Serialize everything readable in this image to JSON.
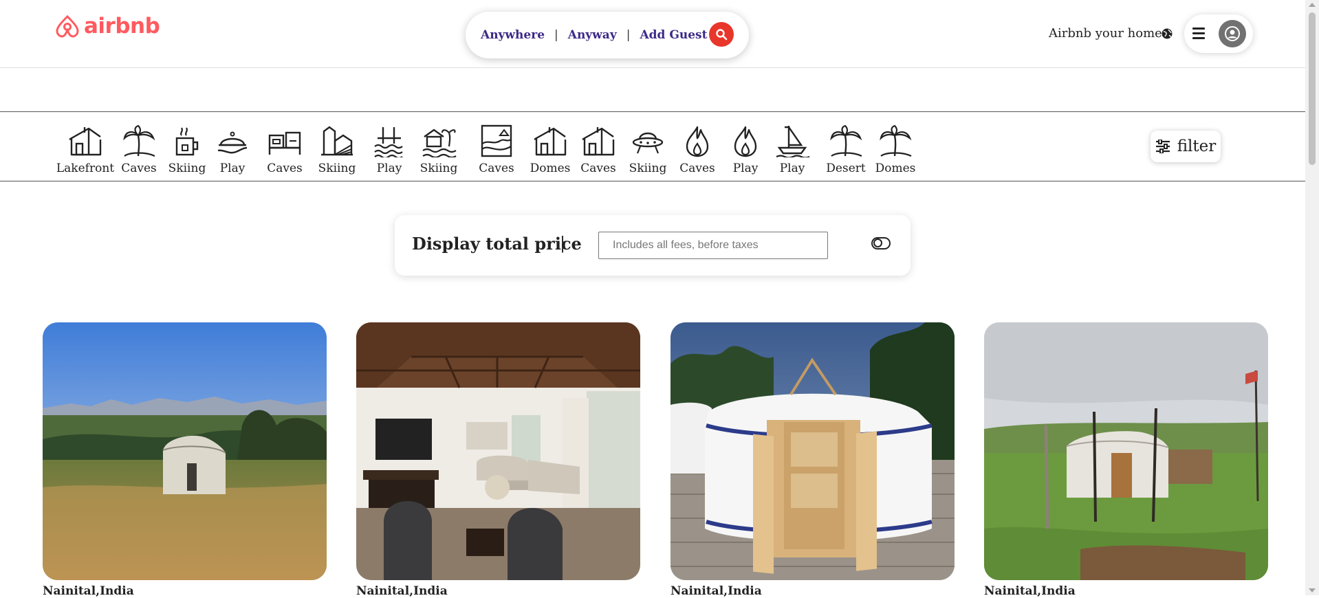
{
  "brand": {
    "name": "airbnb",
    "color": "#ff5a5f"
  },
  "search": {
    "segments": [
      "Anywhere",
      "Anyway",
      "Add Guest"
    ],
    "button_icon": "search-icon",
    "button_color": "#e8362a"
  },
  "header": {
    "host_link": "Airbnb your home",
    "globe_icon": "globe-icon",
    "menu_icon": "hamburger-icon",
    "avatar_icon": "user-avatar-icon"
  },
  "categories": [
    {
      "label": "Lakefront",
      "icon": "house-icon"
    },
    {
      "label": "Caves",
      "icon": "palm-tree-icon"
    },
    {
      "label": "Skiing",
      "icon": "hot-drink-icon"
    },
    {
      "label": "Play",
      "icon": "cloche-icon"
    },
    {
      "label": "Caves",
      "icon": "bed-icon"
    },
    {
      "label": "Skiing",
      "icon": "farm-icon"
    },
    {
      "label": "Play",
      "icon": "pier-icon"
    },
    {
      "label": "Skiing",
      "icon": "beach-hut-icon"
    },
    {
      "label": "Caves",
      "icon": "beachfront-icon"
    },
    {
      "label": "Domes",
      "icon": "house-icon"
    },
    {
      "label": "Caves",
      "icon": "house-icon"
    },
    {
      "label": "Skiing",
      "icon": "ufo-icon"
    },
    {
      "label": "Caves",
      "icon": "flame-icon"
    },
    {
      "label": "Play",
      "icon": "flame-icon"
    },
    {
      "label": "Play",
      "icon": "sailboat-icon"
    },
    {
      "label": "Desert",
      "icon": "palm-tree-icon"
    },
    {
      "label": "Domes",
      "icon": "palm-tree-icon"
    }
  ],
  "filter": {
    "label": "filter",
    "icon": "sliders-icon"
  },
  "price_toggle": {
    "title": "Display total price",
    "separator": "|",
    "placeholder": "Includes all fees, before taxes",
    "toggle_icon": "toggle-icon"
  },
  "listings": [
    {
      "location": "Nainital,India",
      "image": "yurt-meadow-photo"
    },
    {
      "location": "Nainital,India",
      "image": "living-room-photo"
    },
    {
      "location": "Nainital,India",
      "image": "yurt-deck-photo"
    },
    {
      "location": "Nainital,India",
      "image": "yurt-field-photo"
    }
  ]
}
